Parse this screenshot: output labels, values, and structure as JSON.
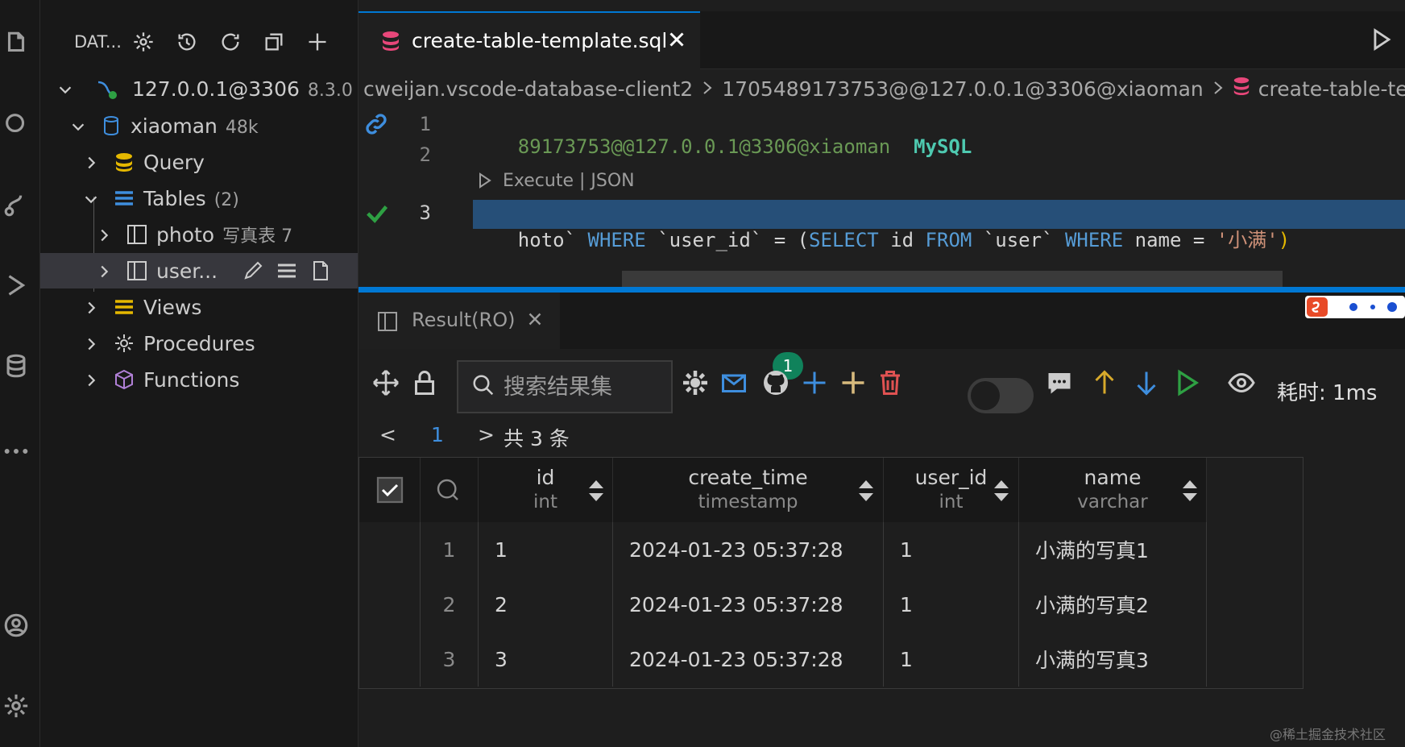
{
  "sidebar": {
    "title": "DAT...",
    "connection": {
      "label": "127.0.0.1@3306",
      "version": "8.3.0"
    },
    "database": {
      "label": "xiaoman",
      "size": "48k"
    },
    "query": "Query",
    "tables": {
      "label": "Tables",
      "count": "(2)"
    },
    "table_photo": {
      "label": "photo",
      "comment": "写真表 7"
    },
    "table_user": {
      "label": "user..."
    },
    "views": "Views",
    "procedures": "Procedures",
    "functions": "Functions"
  },
  "tab": {
    "label": "create-table-template.sql"
  },
  "breadcrumb": {
    "items": [
      "cweijan.vscode-database-client2",
      "1705489173753@@127.0.0.1@3306@xiaoman",
      "create-table-templat"
    ]
  },
  "editor": {
    "line_numbers": [
      "1",
      "2",
      "3"
    ],
    "line1_conn": "89173753@@127.0.0.1@3306@xiaoman",
    "line1_type": "MySQL",
    "codelens": "Execute | JSON",
    "line3": {
      "t1": "hoto`",
      "t2": " WHERE ",
      "t3": "`user_id`",
      "t4": " = (",
      "t5": "SELECT",
      "t6": " id ",
      "t7": "FROM",
      "t8": " `user` ",
      "t9": "WHERE",
      "t10": " name ",
      "t11": "= ",
      "t12": "'小满'",
      "t13": ")"
    }
  },
  "panel": {
    "tab_label": "Result(RO)",
    "search_placeholder": "搜索结果集",
    "badge_count": "1",
    "time": "耗时: 1ms",
    "pager": {
      "prev": "<",
      "page": "1",
      "next": ">",
      "total": "共 3 条"
    },
    "columns": [
      {
        "name": "id",
        "type": "int"
      },
      {
        "name": "create_time",
        "type": "timestamp"
      },
      {
        "name": "user_id",
        "type": "int"
      },
      {
        "name": "name",
        "type": "varchar"
      }
    ],
    "rows": [
      {
        "idx": "1",
        "id": "1",
        "create_time": "2024-01-23 05:37:28",
        "user_id": "1",
        "name": "小满的写真1"
      },
      {
        "idx": "2",
        "id": "2",
        "create_time": "2024-01-23 05:37:28",
        "user_id": "1",
        "name": "小满的写真2"
      },
      {
        "idx": "3",
        "id": "3",
        "create_time": "2024-01-23 05:37:28",
        "user_id": "1",
        "name": "小满的写真3"
      }
    ]
  },
  "watermark": "@稀土掘金技术社区",
  "colors": {
    "accent": "#0078d4",
    "selection": "#264f78",
    "highlight_box": "#e51b1b",
    "success": "#2ea043"
  }
}
